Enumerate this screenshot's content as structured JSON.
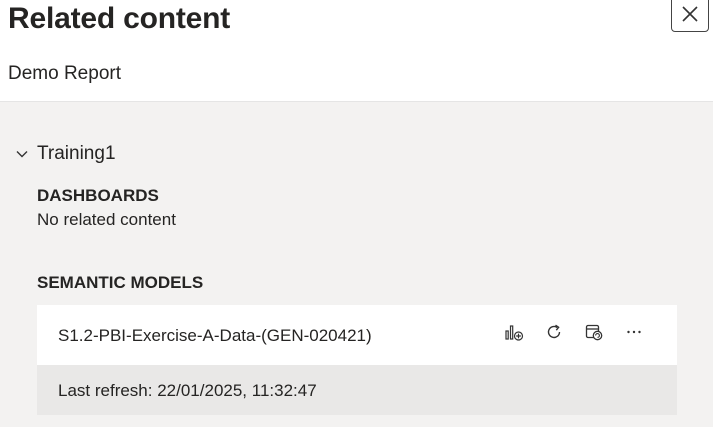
{
  "panel": {
    "title": "Related content",
    "subtitle": "Demo Report",
    "close_icon": "close-icon"
  },
  "group": {
    "name": "Training1",
    "expanded": true,
    "dashboards": {
      "title": "DASHBOARDS",
      "empty_text": "No related content"
    },
    "semantic_models": {
      "title": "SEMANTIC MODELS",
      "items": [
        {
          "name": "S1.2-PBI-Exercise-A-Data-(GEN-020421)",
          "refresh_label": "Last refresh: ",
          "refresh_value": "22/01/2025, 11:32:47",
          "actions": [
            "create-report-icon",
            "refresh-icon",
            "schedule-refresh-icon",
            "more-options-icon"
          ]
        }
      ]
    }
  }
}
